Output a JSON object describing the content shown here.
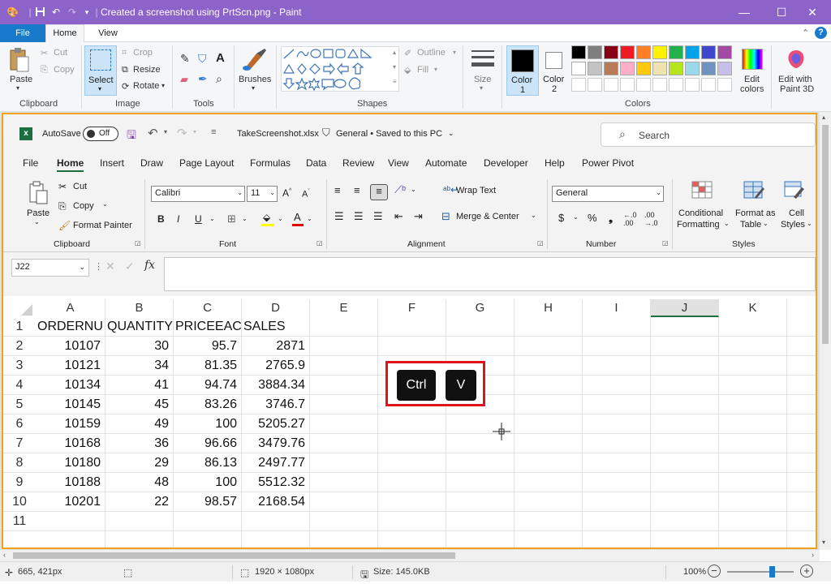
{
  "window": {
    "title": "Created a screenshot using PrtScn.png - Paint",
    "minimize": "—",
    "maximize": "☐",
    "close": "✕"
  },
  "menu": {
    "file": "File",
    "home": "Home",
    "view": "View"
  },
  "ribbon": {
    "clipboard": {
      "paste": "Paste",
      "cut": "Cut",
      "copy": "Copy",
      "label": "Clipboard"
    },
    "image": {
      "select": "Select",
      "crop": "Crop",
      "resize": "Resize",
      "rotate": "Rotate",
      "label": "Image"
    },
    "tools": {
      "label": "Tools"
    },
    "brushes": "Brushes",
    "shapes": {
      "outline": "Outline",
      "fill": "Fill",
      "label": "Shapes"
    },
    "size": "Size",
    "color1": "Color\n1",
    "color1_a": "Color",
    "color1_b": "1",
    "color2_a": "Color",
    "color2_b": "2",
    "colors_label": "Colors",
    "edit_colors_a": "Edit",
    "edit_colors_b": "colors",
    "paint3d_a": "Edit with",
    "paint3d_b": "Paint 3D",
    "palette": [
      "#000000",
      "#7f7f7f",
      "#880015",
      "#ed1c24",
      "#ff7f27",
      "#fff200",
      "#22b14c",
      "#00a2e8",
      "#3f48cc",
      "#a349a4",
      "#ffffff",
      "#c3c3c3",
      "#b97a57",
      "#ffaec9",
      "#ffc90e",
      "#efe4b0",
      "#b5e61d",
      "#99d9ea",
      "#7092be",
      "#c8bfe7"
    ]
  },
  "excel": {
    "autosave": "AutoSave",
    "autosave_state": "Off",
    "filename": "TakeScreenshot.xlsx",
    "sensitivity": "General • Saved to this PC",
    "search_placeholder": "Search",
    "tabs": [
      "File",
      "Home",
      "Insert",
      "Draw",
      "Page Layout",
      "Formulas",
      "Data",
      "Review",
      "View",
      "Automate",
      "Developer",
      "Help",
      "Power Pivot"
    ],
    "clipboard": {
      "paste": "Paste",
      "cut": "Cut",
      "copy": "Copy",
      "format_painter": "Format Painter",
      "label": "Clipboard"
    },
    "font": {
      "name": "Calibri",
      "size": "11",
      "label": "Font"
    },
    "alignment": {
      "wrap": "Wrap Text",
      "merge": "Merge & Center",
      "label": "Alignment"
    },
    "number": {
      "format": "General",
      "label": "Number"
    },
    "styles": {
      "conditional_a": "Conditional",
      "conditional_b": "Formatting",
      "format_table_a": "Format as",
      "format_table_b": "Table",
      "cell_styles_a": "Cell",
      "cell_styles_b": "Styles",
      "label": "Styles"
    },
    "name_box": "J22",
    "columns": [
      "A",
      "B",
      "C",
      "D",
      "E",
      "F",
      "G",
      "H",
      "I",
      "J",
      "K"
    ],
    "rows": [
      "1",
      "2",
      "3",
      "4",
      "5",
      "6",
      "7",
      "8",
      "9",
      "10",
      "11"
    ],
    "headers": [
      "ORDERNU",
      "QUANTITY",
      "PRICEEACH",
      "SALES"
    ],
    "data": [
      [
        "10107",
        "30",
        "95.7",
        "2871"
      ],
      [
        "10121",
        "34",
        "81.35",
        "2765.9"
      ],
      [
        "10134",
        "41",
        "94.74",
        "3884.34"
      ],
      [
        "10145",
        "45",
        "83.26",
        "3746.7"
      ],
      [
        "10159",
        "49",
        "100",
        "5205.27"
      ],
      [
        "10168",
        "36",
        "96.66",
        "3479.76"
      ],
      [
        "10180",
        "29",
        "86.13",
        "2497.77"
      ],
      [
        "10188",
        "48",
        "100",
        "5512.32"
      ],
      [
        "10201",
        "22",
        "98.57",
        "2168.54"
      ]
    ],
    "keys": {
      "ctrl": "Ctrl",
      "v": "V"
    }
  },
  "status": {
    "cursor_pos": "665, 421px",
    "image_size": "1920 × 1080px",
    "file_size": "Size: 145.0KB",
    "zoom": "100%",
    "zoom_level": 0.67
  }
}
